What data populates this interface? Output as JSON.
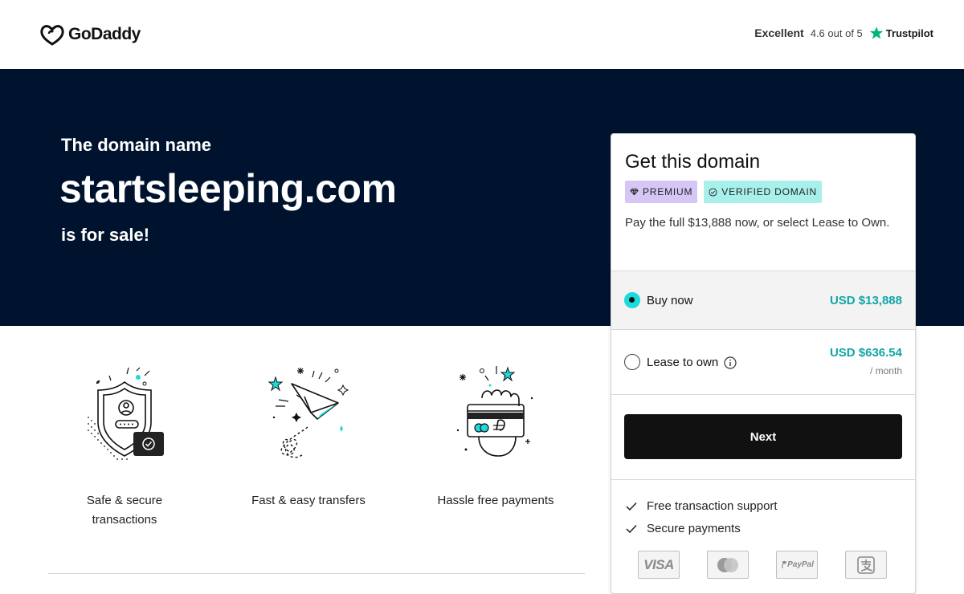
{
  "header": {
    "logo_text": "GoDaddy",
    "trustpilot": {
      "rating_word": "Excellent",
      "rating_text": "4.6 out of 5",
      "brand": "Trustpilot",
      "star_color": "#00b67a"
    }
  },
  "hero": {
    "intro": "The domain name",
    "domain": "startsleeping.com",
    "suffix": "is for sale!",
    "background": "#00132e"
  },
  "features": [
    {
      "icon": "shield-check-icon",
      "label_line1": "Safe & secure",
      "label_line2": "transactions"
    },
    {
      "icon": "paper-plane-icon",
      "label_line1": "Fast & easy transfers"
    },
    {
      "icon": "credit-card-hand-icon",
      "label_line1": "Hassle free payments"
    }
  ],
  "card": {
    "title": "Get this domain",
    "badges": {
      "premium": "PREMIUM",
      "verified": "VERIFIED DOMAIN"
    },
    "description": "Pay the full $13,888 now, or select Lease to Own.",
    "options": {
      "buy": {
        "label": "Buy now",
        "price": "USD $13,888",
        "selected": true
      },
      "lease": {
        "label": "Lease to own",
        "price": "USD $636.54",
        "period": "/ month",
        "selected": false
      }
    },
    "next_label": "Next",
    "perks": [
      "Free transaction support",
      "Secure payments"
    ],
    "payment_methods": {
      "visa": "VISA",
      "paypal": "PayPal"
    },
    "accent_color": "#1bdbdb"
  }
}
